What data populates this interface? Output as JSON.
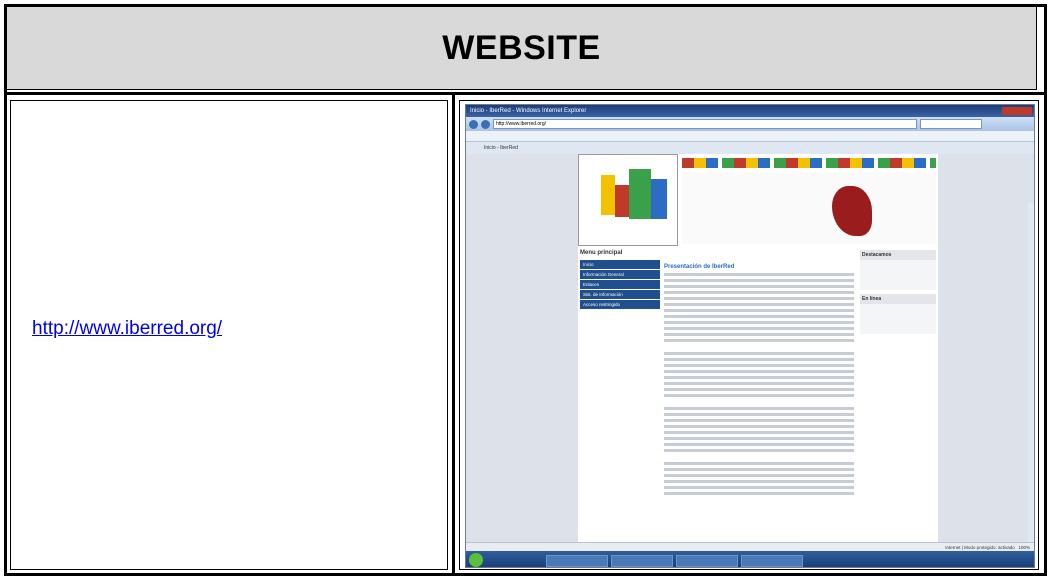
{
  "header": {
    "title": "WEBSITE"
  },
  "link": {
    "url_text": "http://www.iberred.org/"
  },
  "screenshot": {
    "window_title": "Inicio - IberRed - Windows Internet Explorer",
    "address": "http://www.iberred.org/",
    "tab_label": "Inicio - IberRed",
    "page_heading": "Presentación de IberRed",
    "menu_title": "Menu principal",
    "menu_items": [
      "Inicio",
      "Información General",
      "Enlaces",
      "Sist. de Información",
      "Acceso restringido"
    ],
    "side_title": "Destacamos",
    "side_title2": "En línea",
    "status_text": "Internet | Modo protegido: activado",
    "zoom": "100%"
  }
}
